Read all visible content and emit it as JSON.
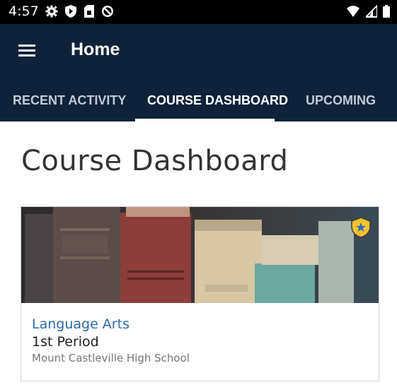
{
  "status_bar": {
    "time": "4:57",
    "left_icons": [
      "gear-icon",
      "shield-play-icon",
      "sim-card-icon",
      "no-disturb-icon"
    ],
    "right_icons": [
      "wifi-icon",
      "cell-signal-icon",
      "battery-icon"
    ]
  },
  "app_bar": {
    "title": "Home",
    "menu_icon": "hamburger-menu-icon",
    "background_color": "#0f2239"
  },
  "tabs": [
    {
      "label": "RECENT ACTIVITY",
      "active": false
    },
    {
      "label": "COURSE DASHBOARD",
      "active": true
    },
    {
      "label": "UPCOMING",
      "active": false
    }
  ],
  "page": {
    "title": "Course Dashboard"
  },
  "course_card": {
    "name": "Language Arts",
    "period": "1st Period",
    "school": "Mount Castleville High School",
    "badge_icon": "shield-star-icon",
    "image": "old-books-photo",
    "link_color": "#2d6aa6"
  }
}
